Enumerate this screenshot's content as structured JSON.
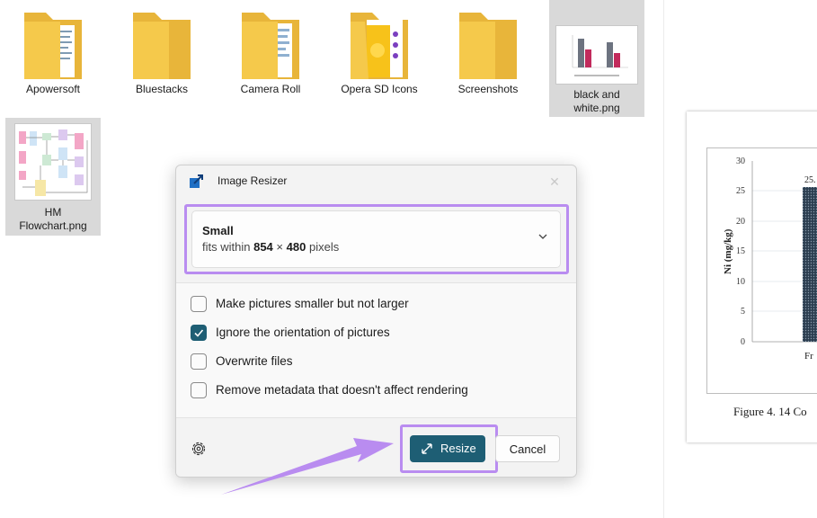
{
  "explorer": {
    "items": [
      {
        "name": "Apowersoft",
        "kind": "folder"
      },
      {
        "name": "Bluestacks",
        "kind": "folder"
      },
      {
        "name": "Camera Roll",
        "kind": "folder"
      },
      {
        "name": "Opera SD Icons",
        "kind": "folder"
      },
      {
        "name": "Screenshots",
        "kind": "folder"
      },
      {
        "name": "black and white.png",
        "kind": "image",
        "selected": true
      },
      {
        "name": "HM Flowchart.png",
        "kind": "image",
        "selected": true
      }
    ]
  },
  "document": {
    "chart": {
      "ylabel": "Ni (mg/kg)",
      "yticks": [
        "30",
        "25",
        "20",
        "15",
        "10",
        "5",
        "0"
      ],
      "bar_label": "25.",
      "x_tick": "Fr"
    },
    "caption": "Figure 4. 14 Co"
  },
  "dialog": {
    "title": "Image Resizer",
    "size": {
      "name": "Small",
      "desc_prefix": "fits within",
      "width": "854",
      "times": "×",
      "height": "480",
      "unit": "pixels"
    },
    "options": [
      {
        "label": "Make pictures smaller but not larger",
        "checked": false
      },
      {
        "label": "Ignore the orientation of pictures",
        "checked": true
      },
      {
        "label": "Overwrite files",
        "checked": false
      },
      {
        "label": "Remove metadata that doesn't affect rendering",
        "checked": false
      }
    ],
    "resize_label": "Resize",
    "cancel_label": "Cancel"
  },
  "colors": {
    "accent": "#1e5e74",
    "highlight": "#b98cf0",
    "folder": "#f5c94b"
  },
  "icons": {
    "app": "image-resizer-icon",
    "close": "close-icon",
    "chevron": "chevron-down-icon",
    "settings": "gear-icon",
    "resize": "expand-arrows-icon",
    "check": "check-icon"
  }
}
